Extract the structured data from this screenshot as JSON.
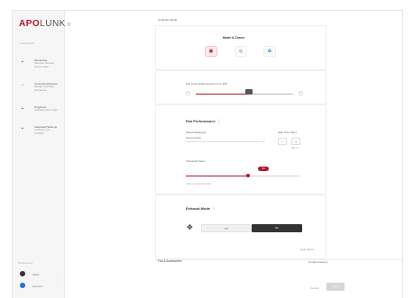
{
  "brand": {
    "logo_a": "APO",
    "logo_b": "LUNK",
    "logo_c": "ll"
  },
  "sidebar": {
    "section_label": "Instruments",
    "items": [
      {
        "title": "Monitoring",
        "sub1": "Real-time overview",
        "sub2": "Sensor status",
        "icon": "monitor-icon"
      },
      {
        "title": "Connected Devices",
        "sub1": "Manage controllers",
        "sub2": "and devices",
        "icon": "link-icon"
      },
      {
        "title": "Programs",
        "sub1": "Schedules and modes",
        "sub2": "",
        "icon": "list-icon"
      },
      {
        "title": "Advanced Settings",
        "sub1": "Configure your",
        "sub2": "controller",
        "icon": "sliders-icon"
      }
    ],
    "footer_label": "Preferences",
    "footer": [
      {
        "label": "Alerts",
        "icon": "bell-icon",
        "color": "#333333"
      },
      {
        "label": "Account",
        "icon": "user-icon",
        "color": "#2a6cd6"
      }
    ]
  },
  "main": {
    "section_title": "Controller Mode",
    "mode_card": {
      "title": "Mode & Zones",
      "buttons": [
        {
          "label": "▣",
          "name": "mode-auto-button",
          "active": true
        },
        {
          "label": "◎",
          "name": "mode-schedule-button",
          "active": false
        },
        {
          "label": "✿",
          "name": "mode-manual-button",
          "active": false
        }
      ]
    },
    "level_card": {
      "label": "Fan level setting speed is 0 to 100",
      "min_icon": "▢",
      "max_icon": "▢",
      "value": 0.55
    },
    "fan_card": {
      "title": "Fan Performance",
      "info": "ⓘ",
      "speed_label": "Speed Setting(s)",
      "speed_value": "Speed Mode",
      "step_label": "Step Size (Sec)",
      "step_minus": "−",
      "step_plus": "+",
      "step_hint": "Sec. 5",
      "threshold_label": "Threshold Value",
      "threshold_badge": "50",
      "threshold_value": 0.55,
      "threshold_hint": "Slide to adjust threshold"
    },
    "direction_card": {
      "title": "Exhaust Mode",
      "info": "ⓘ",
      "seg_off": "Off",
      "seg_on": "On",
      "link": "Learn More ›"
    },
    "footer_row": {
      "title": "Fan & Accessories",
      "link": "⊕  Add Accessory"
    },
    "actions": {
      "cancel": "Cancel",
      "save": "Save"
    }
  }
}
